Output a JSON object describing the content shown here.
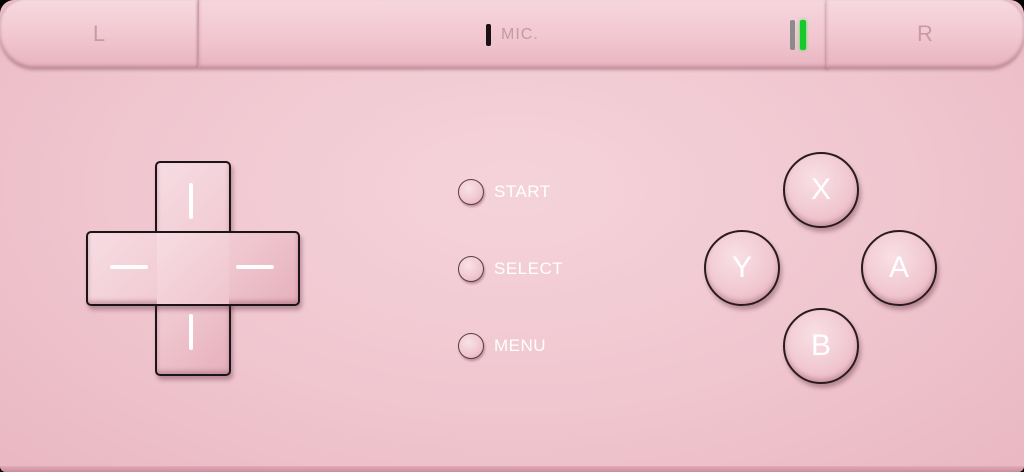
{
  "shoulders": {
    "left_label": "L",
    "right_label": "R"
  },
  "hinge": {
    "mic_label": "MIC.",
    "power_led_color": "#17c92c",
    "charge_led_color": "#8d8a8c"
  },
  "menu_buttons": {
    "start_label": "START",
    "select_label": "SELECT",
    "menu_label": "MENU"
  },
  "face_buttons": {
    "x_label": "X",
    "y_label": "Y",
    "a_label": "A",
    "b_label": "B"
  },
  "theme": {
    "body_color": "#f0c6cf",
    "accent_text": "#ffffff",
    "outline": "#1b1418"
  },
  "icons": {
    "dpad": "dpad-cross-icon"
  }
}
